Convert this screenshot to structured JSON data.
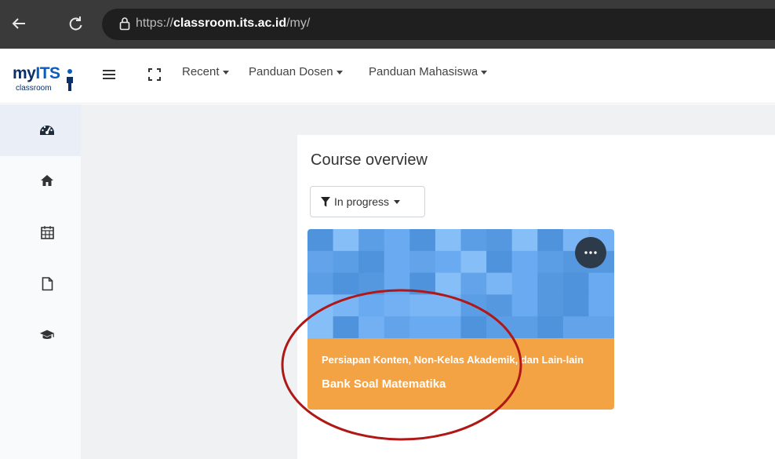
{
  "browser": {
    "url_prefix": "https://",
    "url_host": "classroom.its.ac.id",
    "url_path": "/my/"
  },
  "logo": {
    "main_lower": "my",
    "main_upper": "ITS",
    "sub": "classroom"
  },
  "nav": {
    "items": [
      {
        "label": "Recent"
      },
      {
        "label": "Panduan Dosen"
      },
      {
        "label": "Panduan Mahasiswa"
      }
    ]
  },
  "sidebar": {
    "items": [
      {
        "icon": "dashboard-icon"
      },
      {
        "icon": "home-icon"
      },
      {
        "icon": "calendar-icon"
      },
      {
        "icon": "file-icon"
      },
      {
        "icon": "graduation-cap-icon"
      }
    ]
  },
  "main": {
    "title": "Course overview",
    "filter_label": "In progress",
    "course": {
      "category": "Persiapan Konten, Non-Kelas Akademik, dan Lain-lain",
      "name": "Bank Soal Matematika",
      "footer_color": "#f4a344"
    }
  },
  "annotation": {
    "color": "#b01818"
  }
}
